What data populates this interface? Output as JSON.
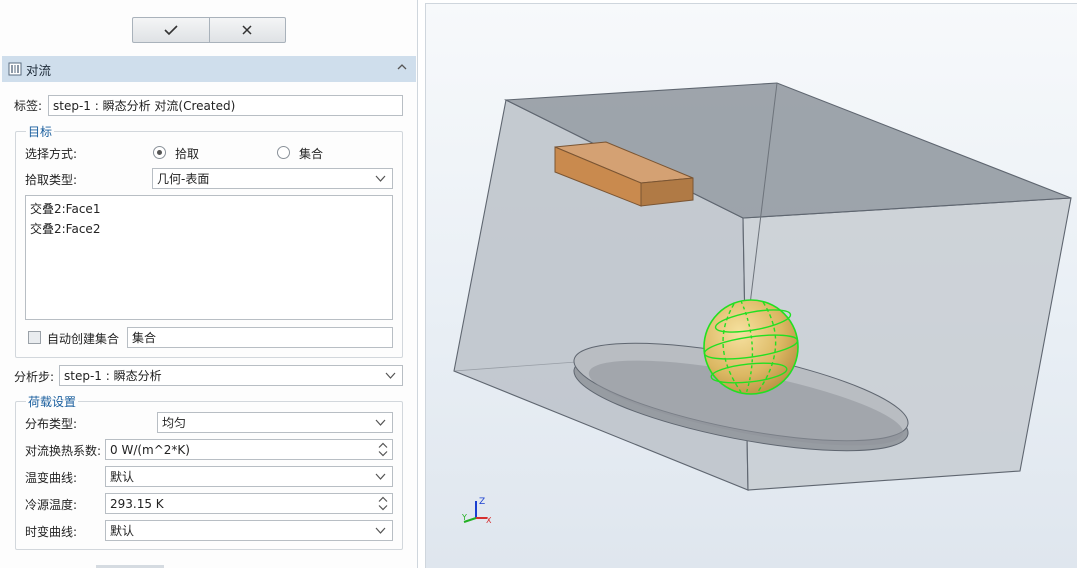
{
  "toolbar": {
    "ok_icon": "check-icon",
    "cancel_icon": "close-icon"
  },
  "section": {
    "title": "对流",
    "icon": "convection-icon"
  },
  "tag": {
    "label": "标签:",
    "value": "step-1 : 瞬态分析 对流(Created)"
  },
  "target": {
    "group_title": "目标",
    "select_mode_label": "选择方式:",
    "option_pick": "拾取",
    "option_set": "集合",
    "selected": "拾取",
    "pick_type_label": "拾取类型:",
    "pick_type_value": "几何-表面",
    "items": [
      "交叠2:Face1",
      "交叠2:Face2"
    ],
    "auto_create_label": "自动创建集合",
    "auto_create_checked": false,
    "set_name_value": "集合"
  },
  "analysis_step": {
    "label": "分析步:",
    "value": "step-1 : 瞬态分析"
  },
  "load": {
    "group_title": "荷载设置",
    "distribution_label": "分布类型:",
    "distribution_value": "均匀",
    "coefficient_label": "对流换热系数:",
    "coefficient_value": "0 W/(m^2*K)",
    "temp_curve_label": "温变曲线:",
    "temp_curve_value": "默认",
    "sink_temp_label": "冷源温度:",
    "sink_temp_value": "293.15 K",
    "time_curve_label": "时变曲线:",
    "time_curve_value": "默认"
  },
  "viewport": {
    "triad_axis_x": "X",
    "triad_axis_y": "Y",
    "triad_axis_z": "Z",
    "colors": {
      "box_edge": "#5f6670",
      "block": "#c98a4e",
      "sphere": "#e4c46e",
      "highlight": "#22e022",
      "disc": "#b9bdc2"
    }
  }
}
